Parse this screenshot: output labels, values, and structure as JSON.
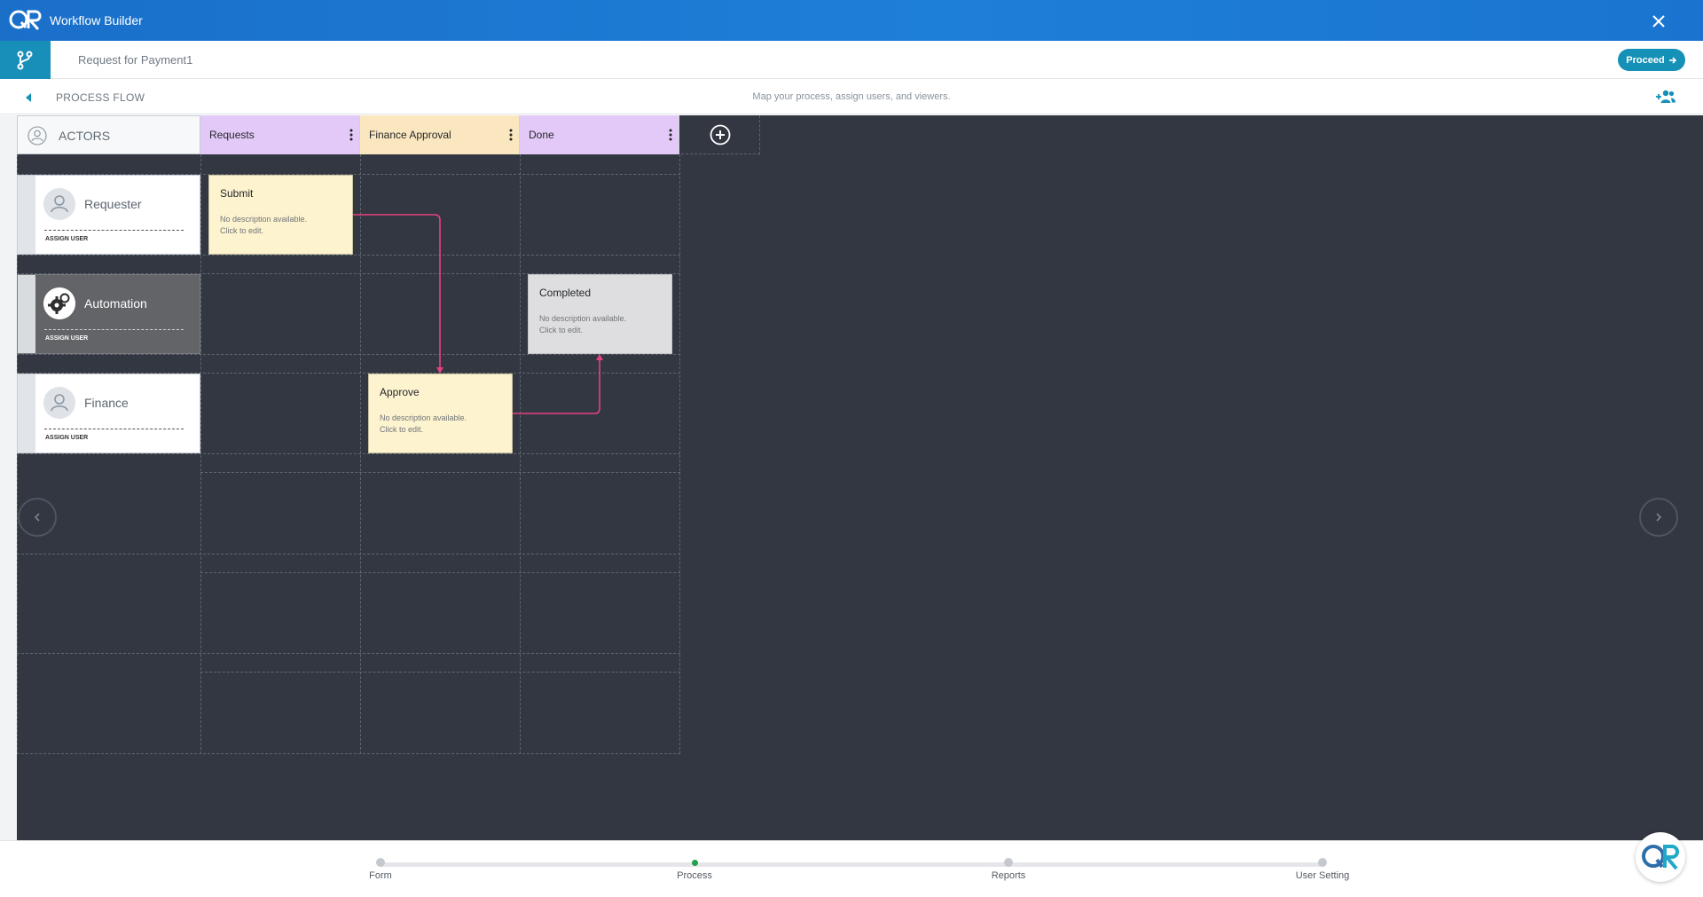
{
  "window": {
    "title": "Workflow Builder"
  },
  "header": {
    "form_title": "Request for Payment1",
    "proceed_label": "Proceed"
  },
  "section": {
    "title": "PROCESS FLOW",
    "subtitle": "Map your process, assign users, and viewers."
  },
  "board": {
    "actors_label": "ACTORS",
    "lanes": [
      {
        "label": "Requests",
        "color": "#e3c9f7"
      },
      {
        "label": "Finance Approval",
        "color": "#fbe7bf"
      },
      {
        "label": "Done",
        "color": "#e3c9f7"
      }
    ],
    "actors": [
      {
        "name": "Requester",
        "assign_label": "ASSIGN USER"
      },
      {
        "name": "Automation",
        "assign_label": "ASSIGN USER"
      },
      {
        "name": "Finance",
        "assign_label": "ASSIGN USER"
      }
    ],
    "steps": [
      {
        "title": "Submit",
        "description": "No description available. Click to edit."
      },
      {
        "title": "Completed",
        "description": "No description available. Click to edit."
      },
      {
        "title": "Approve",
        "description": "No description available. Click to edit."
      }
    ],
    "connector_color": "#e6417f"
  },
  "footer": {
    "steps": [
      {
        "label": "Form"
      },
      {
        "label": "Process",
        "active": true
      },
      {
        "label": "Reports"
      },
      {
        "label": "User Setting"
      }
    ]
  },
  "colors": {
    "brand": "#1a6fc9",
    "accent": "#1590b6",
    "canvas": "#333741",
    "active_step": "#20a04a"
  }
}
